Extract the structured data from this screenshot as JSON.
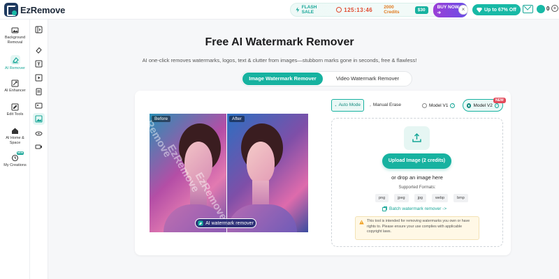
{
  "app": {
    "name": "EzRemove"
  },
  "promo": {
    "flash_sale": "FLASH SALE",
    "timer": "125:13:46",
    "credits": "2000 Credits",
    "price": "$30",
    "buy_now": "BUY NOW",
    "close": "×",
    "discount": "Up to 67% Off",
    "coins": "0"
  },
  "sidebar": {
    "items": [
      {
        "label_line1": "Background",
        "label_line2": "Removal",
        "icon": "image-icon"
      },
      {
        "label_line1": "AI Remover",
        "label_line2": "",
        "icon": "eraser-icon",
        "active": true
      },
      {
        "label_line1": "AI Enhancer",
        "label_line2": "",
        "icon": "enhance-icon"
      },
      {
        "label_line1": "Edit Tools",
        "label_line2": "",
        "icon": "edit-icon"
      },
      {
        "label_line1": "AI Home &",
        "label_line2": "Space",
        "icon": "home-icon"
      },
      {
        "label_line1": "My Creations",
        "label_line2": "",
        "icon": "history-icon",
        "badge": "NEW"
      }
    ]
  },
  "main": {
    "title": "Free AI Watermark Remover",
    "subtitle": "AI one-click removes watermarks, logos, text & clutter from images—stubborn marks gone in seconds, free & flawless!",
    "tabs": [
      "Image Watermark Remover",
      "Video Watermark Remover"
    ],
    "preview": {
      "before_label": "Before",
      "after_label": "After",
      "watermark_text": "EzRemove",
      "pill": "AI watermark remover"
    },
    "modes": {
      "auto": "Auto Mode",
      "manual": "Manual Erase"
    },
    "models": {
      "v1": "Model V1",
      "v2": "Model V2",
      "new_badge": "NEW"
    },
    "upload": {
      "button": "Upload Image (2 credits)",
      "or_drop": "or drop an image here",
      "supported": "Supported Formats:",
      "formats": [
        "png",
        "jpeg",
        "jpg",
        "webp",
        "bmp"
      ],
      "batch": "Batch watermark remover ->",
      "notice": "This tool is intended for removing watermarks you own or have rights to. Please ensure your use complies with applicable copyright laws."
    }
  },
  "colors": {
    "accent": "#17b2a0",
    "timer": "#e04a2f",
    "credits": "#e07a1f",
    "buy": "#7a46e0"
  }
}
